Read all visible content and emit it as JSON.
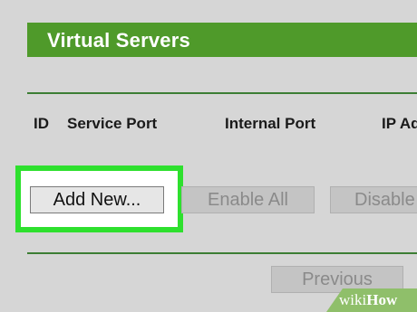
{
  "section": {
    "title": "Virtual Servers"
  },
  "table": {
    "columns": [
      "ID",
      "Service Port",
      "Internal Port",
      "IP Ad"
    ]
  },
  "buttons": {
    "add_new": "Add New...",
    "enable_all": "Enable All",
    "disable": "Disable",
    "previous": "Previous"
  },
  "watermark": {
    "wiki": "wiki",
    "how": "How"
  },
  "colors": {
    "header_bg": "#4f9a2a",
    "highlight": "#2ee02e",
    "page_bg": "#d6d6d6"
  }
}
